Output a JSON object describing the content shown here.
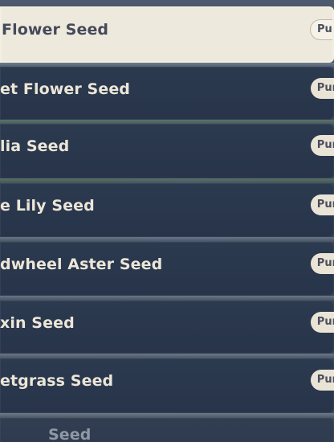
{
  "seeds": [
    {
      "name": "Flower Seed",
      "action": "Pu"
    },
    {
      "name": "et Flower Seed",
      "action": "Pur"
    },
    {
      "name": "lia Seed",
      "action": "Pur"
    },
    {
      "name": "e Lily Seed",
      "action": "Pur"
    },
    {
      "name": "dwheel Aster Seed",
      "action": "Pur"
    },
    {
      "name": "xin Seed",
      "action": "Pur"
    },
    {
      "name": "etgrass Seed",
      "action": "Pur"
    },
    {
      "name": "Seed",
      "action": ""
    }
  ]
}
